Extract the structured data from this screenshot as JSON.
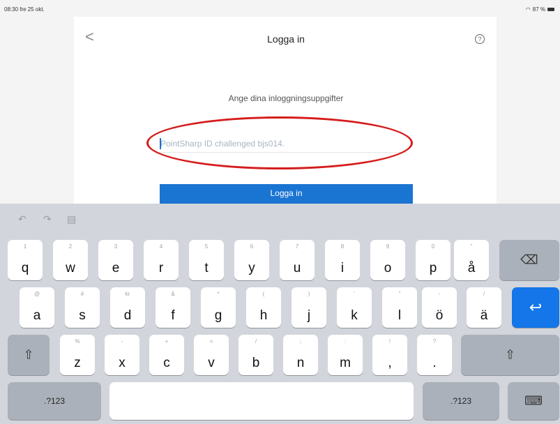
{
  "status_bar": {
    "time_date": "08:30 fre 25 okt.",
    "battery": "87 %"
  },
  "nav": {
    "title": "Logga in",
    "back_icon": "chevron-left-icon",
    "help_icon": "question-mark-circle-icon"
  },
  "login": {
    "subtitle": "Ange dina inloggningsuppgifter",
    "field_placeholder": "PointSharp ID challenged bjs014.",
    "field_value": "",
    "button_label": "Logga in",
    "highlight_color": "#d51c1c"
  },
  "keyboard": {
    "toolbar": {
      "undo_icon": "undo-icon",
      "redo_icon": "redo-icon",
      "paste_icon": "clipboard-icon"
    },
    "row1": [
      {
        "main": "q",
        "sub": "1"
      },
      {
        "main": "w",
        "sub": "2"
      },
      {
        "main": "e",
        "sub": "3"
      },
      {
        "main": "r",
        "sub": "4"
      },
      {
        "main": "t",
        "sub": "5"
      },
      {
        "main": "y",
        "sub": "6"
      },
      {
        "main": "u",
        "sub": "7"
      },
      {
        "main": "i",
        "sub": "8"
      },
      {
        "main": "o",
        "sub": "9"
      },
      {
        "main": "p",
        "sub": "0"
      },
      {
        "main": "å",
        "sub": "\""
      }
    ],
    "row2": [
      {
        "main": "a",
        "sub": "@"
      },
      {
        "main": "s",
        "sub": "#"
      },
      {
        "main": "d",
        "sub": "kr"
      },
      {
        "main": "f",
        "sub": "&"
      },
      {
        "main": "g",
        "sub": "*"
      },
      {
        "main": "h",
        "sub": "("
      },
      {
        "main": "j",
        "sub": ")"
      },
      {
        "main": "k",
        "sub": "'"
      },
      {
        "main": "l",
        "sub": "\""
      },
      {
        "main": "ö",
        "sub": "-"
      },
      {
        "main": "ä",
        "sub": "/"
      }
    ],
    "row3": [
      {
        "main": "z",
        "sub": "%"
      },
      {
        "main": "x",
        "sub": "-"
      },
      {
        "main": "c",
        "sub": "+"
      },
      {
        "main": "v",
        "sub": "="
      },
      {
        "main": "b",
        "sub": "/"
      },
      {
        "main": "n",
        "sub": ";"
      },
      {
        "main": "m",
        "sub": ":"
      },
      {
        "main": ",",
        "sub": "!"
      },
      {
        "main": ".",
        "sub": "?"
      }
    ],
    "numbers_label": ".?123",
    "backspace_icon": "backspace-icon",
    "return_icon": "return-icon",
    "shift_icon": "shift-icon",
    "dismiss_icon": "keyboard-dismiss-icon",
    "return_color": "#1476e8"
  }
}
